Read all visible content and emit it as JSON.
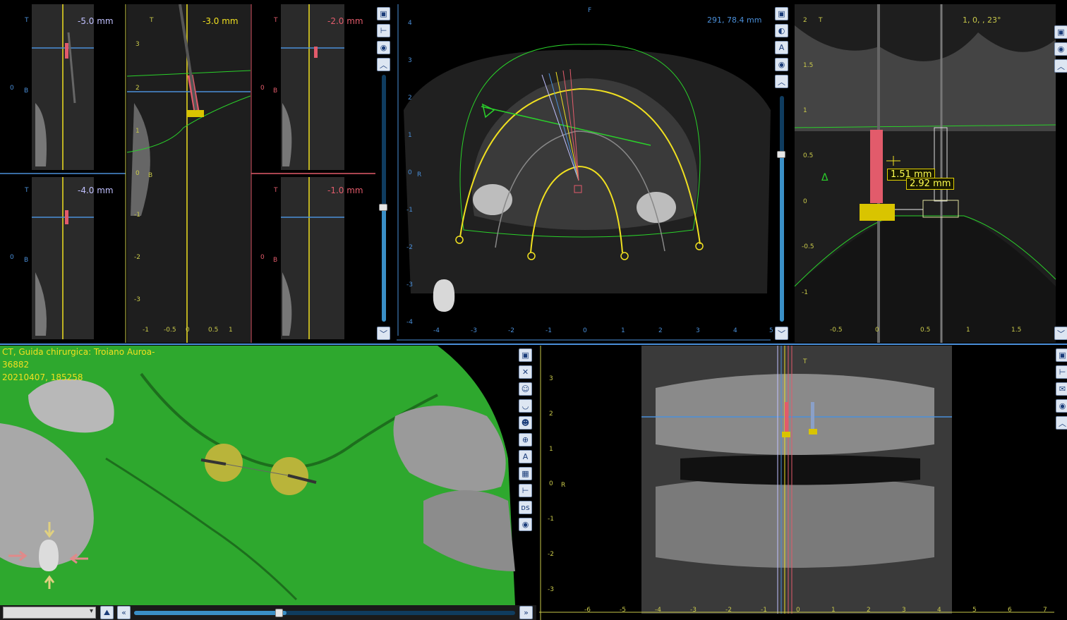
{
  "crossSections": {
    "tl": {
      "label": "-5.0 mm",
      "t": "T",
      "b": "B",
      "axis0": "0"
    },
    "tc": {
      "label": "-3.0 mm",
      "t": "T",
      "b": "B",
      "ticks": [
        "3",
        "2",
        "1",
        "0",
        "-1",
        "-2",
        "-3"
      ],
      "xticks": [
        "-1",
        "-0.5",
        "0",
        "0.5",
        "1"
      ]
    },
    "tr": {
      "label": "-2.0 mm",
      "t": "T",
      "b": "B",
      "axis0": "0"
    },
    "bl": {
      "label": "-4.0 mm",
      "t": "T",
      "b": "B",
      "axis0": "0"
    },
    "br": {
      "label": "-1.0 mm",
      "t": "T",
      "b": "B",
      "axis0": "0"
    }
  },
  "axial": {
    "coord": "291, 78.4 mm",
    "top": "F",
    "side": "R",
    "yticks": [
      "4",
      "3",
      "2",
      "1",
      "0",
      "-1",
      "-2",
      "-3",
      "-4"
    ],
    "xticks": [
      "-4",
      "-3",
      "-2",
      "-1",
      "0",
      "1",
      "2",
      "3",
      "4",
      "5"
    ]
  },
  "implantView": {
    "angle": "1, 0, , 23°",
    "t": "T",
    "delta": "Δ",
    "m1": "1.51 mm",
    "m2": "2.92 mm",
    "yticks": [
      "2",
      "1.5",
      "1",
      "0.5",
      "0",
      "-0.5",
      "-1"
    ],
    "xticks": [
      "-0.5",
      "0",
      "0.5",
      "1",
      "1.5"
    ]
  },
  "model3d": {
    "line1": "CT, Guida chirurgica: Troiano Auroa-",
    "line2": "36882",
    "line3": "20210407, 185258"
  },
  "panoramic": {
    "t": "T",
    "r": "R",
    "yticks": [
      "3",
      "2",
      "1",
      "0",
      "-1",
      "-2",
      "-3"
    ],
    "xticks": [
      "-6",
      "-5",
      "-4",
      "-3",
      "-2",
      "-1",
      "0",
      "1",
      "2",
      "3",
      "4",
      "5",
      "6",
      "7"
    ]
  },
  "bottomBar": {
    "dropdown": "",
    "sliderValue": 0.4
  },
  "colors": {
    "yellow": "#f0e020",
    "green": "#2ad12a",
    "blue": "#4a8fd9",
    "red": "#e25b6b"
  }
}
